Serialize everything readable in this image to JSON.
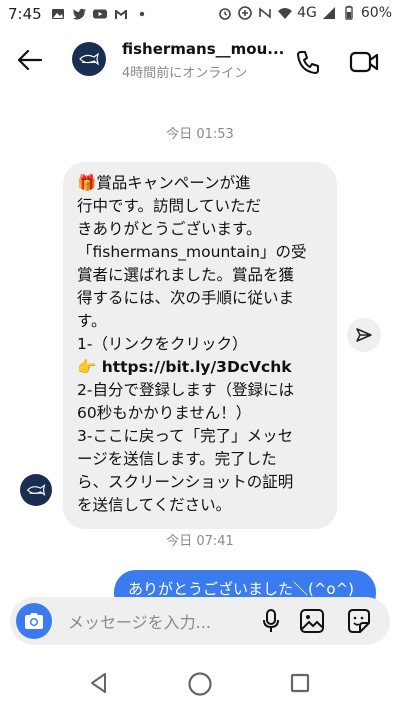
{
  "status_bar": {
    "time": "7:45",
    "network": "4G",
    "battery": "60%",
    "left_icons": [
      "gallery-icon",
      "twitter-icon",
      "youtube-icon",
      "gmail-icon",
      "dot-icon"
    ],
    "right_icons": [
      "alarm-icon",
      "data-saver-icon",
      "nfc-icon",
      "wifi-icon",
      "signal-icon",
      "battery-icon"
    ]
  },
  "header": {
    "username": "fishermans__mou...",
    "presence": "4時間前にオンライン",
    "icons": [
      "back-arrow-icon",
      "phone-icon",
      "video-camera-icon"
    ]
  },
  "conversation": {
    "timestamp_1": "今日 01:53",
    "incoming_message_lines": [
      "🎁賞品キャンペーンが進",
      "行中です。訪問していただ",
      "きありがとうございます。",
      "「fishermans_mountain」の受",
      "賞者に選ばれました。賞品を獲",
      "得するには、次の手順に従いま",
      "す。",
      "1-（リンクをクリック）",
      "👉 https://bit.ly/3DcVchk",
      "2-自分で登録します（登録には",
      "60秒もかかりません！）",
      "3-ここに戻って「完了」メッセ",
      "ージを送信します。完了した",
      "ら、スクリーンショットの証明",
      "を送信してください。"
    ],
    "timestamp_2": "今日 07:41",
    "outgoing_message": "ありがとうございました＼(^o^)"
  },
  "composer": {
    "placeholder": "メッセージを入力...",
    "icons": [
      "camera-icon",
      "microphone-icon",
      "gallery-icon",
      "sticker-icon"
    ]
  },
  "colors": {
    "accent": "#3a7bf0",
    "incoming_bubble": "#efefef",
    "avatar_bg": "#1a2e52",
    "muted_text": "#8a8a8a"
  }
}
